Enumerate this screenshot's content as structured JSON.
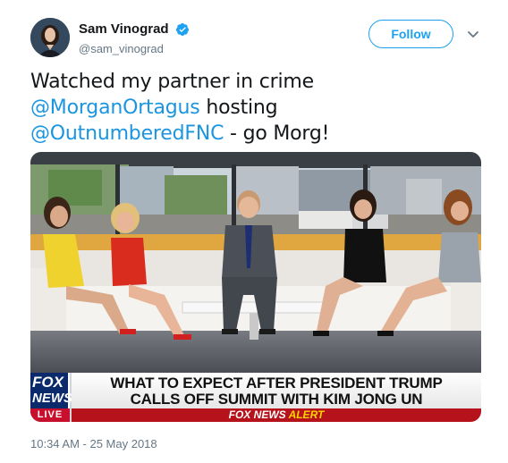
{
  "user": {
    "display_name": "Sam Vinograd",
    "handle": "@sam_vinograd",
    "verified_icon": "verified-badge-icon"
  },
  "follow_label": "Follow",
  "tweet": {
    "line1": "Watched my partner in crime",
    "mention1": "@MorganOrtagus",
    "after_mention1": " hosting",
    "mention2": "@OutnumberedFNC",
    "after_mention2": " - go Morg!"
  },
  "media": {
    "logo_top": "FOX",
    "logo_middle": "NEWS",
    "logo_bottom": "LIVE",
    "headline_line1": "WHAT TO EXPECT AFTER PRESIDENT TRUMP",
    "headline_line2": "CALLS OFF SUMMIT WITH KIM JONG UN",
    "alert_prefix": "FOX NEWS",
    "alert_word": "ALERT"
  },
  "timestamp": "10:34 AM - 25 May 2018",
  "colors": {
    "link": "#1b95e0",
    "follow_border": "#1da1f2",
    "fox_blue": "#0a2a6b",
    "alert_red": "#b5121b"
  }
}
